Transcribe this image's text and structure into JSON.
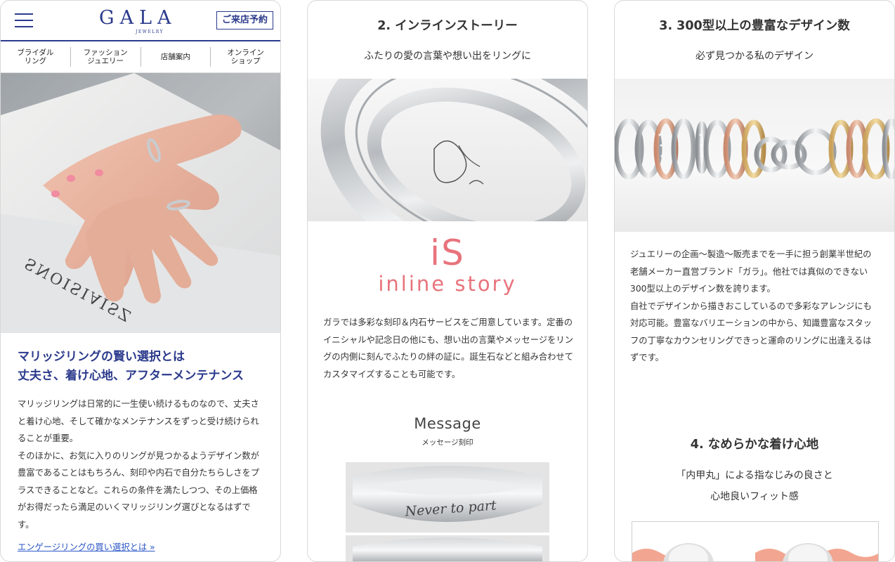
{
  "panel1": {
    "header": {
      "logo_main": "GALA",
      "logo_sub": "JEWELRY",
      "reserve_label": "ご来店予約"
    },
    "nav": [
      {
        "label": "ブライダル\nリング"
      },
      {
        "label": "ファッション\nジュエリー"
      },
      {
        "label": "店舗案内"
      },
      {
        "label": "オンライン\nショップ"
      }
    ],
    "heading_line1": "マリッジリングの賢い選択とは",
    "heading_line2": "丈夫さ、着け心地、アフターメンテナンス",
    "body": "マリッジリングは日常的に一生使い続けるものなので、丈夫さと着け心地、そして確かなメンテナンスをずっと受け続けられることが重要。\nそのほかに、お気に入りのリングが見つかるようデザイン数が豊富であることはもちろん、刻印や内石で自分たちらしさをプラスできることなど。これらの条件を満たしつつ、その上価格がお得だったら満足のいくマリッジリング選びとなるはずです。",
    "link_label": "エンゲージリングの買い選択とは »"
  },
  "panel2": {
    "title": "2. インラインストーリー",
    "subtitle": "ふたりの愛の言葉や想い出をリングに",
    "logo_big": "iS",
    "logo_small": "inline story",
    "body": "ガラでは多彩な刻印＆内石サービスをご用意しています。定番のイニシャルや記念日の他にも、想い出の言葉やメッセージをリングの内側に刻んでふたりの絆の証に。誕生石などと組み合わせてカスタマイズすることも可能です。",
    "message_title": "Message",
    "message_sub": "メッセージ刻印",
    "engraving_text": "Never to part"
  },
  "panel3": {
    "title": "3. 300型以上の豊富なデザイン数",
    "subtitle": "必ず見つかる私のデザイン",
    "body": "ジュエリーの企画〜製造〜販売までを一手に担う創業半世紀の老舗メーカー直営ブランド「ガラ」。他社では真似のできない300型以上のデザイン数を誇ります。\n自社でデザインから描きおこしているので多彩なアレンジにも対応可能。豊富なバリエーションの中から、知識豊富なスタッフの丁寧なカウンセリングできっと運命のリングに出逢えるはずです。",
    "title2": "4. なめらかな着け心地",
    "subtitle2": "「内甲丸」による指なじみの良さと\n心地良いフィット感"
  },
  "colors": {
    "brand_navy": "#2b3a8c",
    "accent_pink": "#e8737c",
    "link_blue": "#2a56c6"
  }
}
